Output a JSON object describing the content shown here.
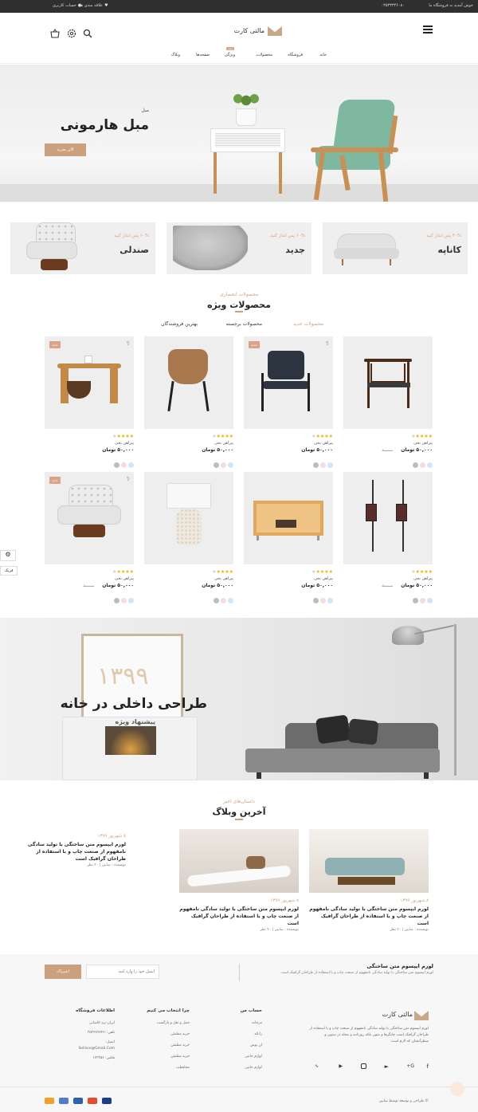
{
  "topbar": {
    "welcome": "خوش آمدید به فروشگاه ما",
    "phone": "۰۳۵۳۳۳۴۶۰۸۰",
    "account": "حساب کاربری",
    "wishlist": "علاقه مندی ها",
    "user_icon": "user-icon",
    "heart_icon": "heart-icon"
  },
  "header": {
    "logo_text": "مالتی کارت",
    "menu_icon": "menu-icon",
    "search_icon": "search-icon",
    "settings_icon": "gear-icon",
    "cart_icon": "basket-icon"
  },
  "nav": {
    "items": [
      "خانه",
      "فروشگاه",
      "محصولات",
      "ویژگی",
      "صفحه‌ها",
      "وبلاگ"
    ],
    "hot_badge": "جدید"
  },
  "hero": {
    "subtitle": "مبل",
    "title": "مبل هارمونی",
    "button": "الان بخرید"
  },
  "categories": [
    {
      "offer": "۳۰% پس انداز کنید",
      "name": "کاناپه"
    },
    {
      "offer": "۶۰% پس انداز کنید",
      "name": "جدید"
    },
    {
      "offer": "۶۰% پس انداز کنید",
      "name": "صندلی"
    }
  ],
  "products_section": {
    "kicker": "محصولات انحصاری",
    "title": "محصولات ویژه",
    "tabs": [
      "محصولات جدید",
      "محصولات برجسته",
      "بهترین فروشندگان"
    ]
  },
  "products": [
    {
      "name": "پیراهن نخی",
      "price": "۵۰,۰۰۰ تومان",
      "old": "۶۰,۰۰۰",
      "new": "",
      "hot": "",
      "img": "chair-wood"
    },
    {
      "name": "پیراهن نخی",
      "price": "۵۰,۰۰۰ تومان",
      "old": "",
      "new": "جدید",
      "hot": "داغ",
      "img": "office-chair"
    },
    {
      "name": "پیراهن نخی",
      "price": "۵۰,۰۰۰ تومان",
      "old": "",
      "new": "",
      "hot": "",
      "img": "lounge-chair"
    },
    {
      "name": "پیراهن نخی",
      "price": "۵۰,۰۰۰ تومان",
      "old": "",
      "new": "جدید",
      "hot": "داغ",
      "img": "side-table"
    },
    {
      "name": "پیراهن نخی",
      "price": "۵۰,۰۰۰ تومان",
      "old": "۶۰,۰۰۰",
      "new": "",
      "hot": "",
      "img": "lanterns"
    },
    {
      "name": "پیراهن نخی",
      "price": "۵۰,۰۰۰ تومان",
      "old": "",
      "new": "",
      "hot": "",
      "img": "coffee-table"
    },
    {
      "name": "پیراهن نخی",
      "price": "۵۰,۰۰۰ تومان",
      "old": "",
      "new": "",
      "hot": "",
      "img": "lamp"
    },
    {
      "name": "پیراهن نخی",
      "price": "۵۰,۰۰۰ تومان",
      "old": "۶۰,۰۰۰",
      "new": "جدید",
      "hot": "داغ",
      "img": "armchair"
    }
  ],
  "side_widget": {
    "label": "فریک",
    "gear_icon": "gear-icon"
  },
  "banner": {
    "year": "۱۳۹۹",
    "title": "طراحی داخلی در خانه",
    "subtitle": "پیشنهاد ویژه"
  },
  "blog": {
    "kicker": "داستان‌های اخیر",
    "title": "آخرین وبلاگ",
    "posts": [
      {
        "date": "۸ شهریور ۱۳۹۹",
        "text": "لورم ایپسوم متن ساختگی با تولید سادگی نامفهوم از صنعت چاپ و با استفاده از طراحان گرافیک است",
        "meta": "نویسنده : سایین | ۲۰ نظر"
      },
      {
        "date": "۸ شهریور ۱۳۹۹",
        "text": "لورم ایپسوم متن ساختگی با تولید سادگی نامفهوم از صنعت چاپ و با استفاده از طراحان گرافیک است",
        "meta": "نویسنده : سایین | ۲۰ نظر"
      },
      {
        "date": "۸ شهریور ۱۳۹۹",
        "text": "لورم ایپسوم متن ساختگی با تولید سادگی نامفهوم از صنعت چاپ و با استفاده از طراحان گرافیک است",
        "meta": "نویسنده : سایین | ۲۰ نظر"
      }
    ]
  },
  "newsletter": {
    "title": "لورم ایپسوم متن ساختگی",
    "text": "لورم ایپسوم متن ساختگی با تولید سادگی نامفهوم از صنعت چاپ و با استفاده از طراحان گرافیک است",
    "placeholder": "ایمیل خود را وارد کنید",
    "button": "اشتراک"
  },
  "footer": {
    "logo_text": "مالتی کارت",
    "about": "لورم ایپسوم متن ساختگی با تولید سادگی نامفهوم از صنعت چاپ و با استفاده از طراحان گرافیک است چاپگرها و متون بلکه روزنامه و مجله در ستون و سطرآنچنان که لازم است",
    "col_account_title": "حساب من",
    "col_account": [
      "مرجانه",
      "رانکه",
      "ان پوش",
      "لوازم جانبی",
      "لوازم جانبی"
    ],
    "col_why_title": "چرا انتخاب می کنیم",
    "col_why": [
      "حمل و نقل و بازگشت",
      "خرید مطمئن",
      "خرید مطمئن",
      "خرید مطمئن",
      "محافظت"
    ],
    "col_info_title": "اطلاعات فروشگاه",
    "col_info": [
      "ایران-یزد-کاشانی",
      "تلفن:۳۵۳۲۷۷۲۴۶۰",
      "ایمیل:",
      "Selinco@Gmail.Com",
      "فکس: ۱۲۳۴۵۶"
    ],
    "social": [
      "facebook-icon",
      "google-plus-icon",
      "twitter-icon",
      "instagram-icon",
      "youtube-icon",
      "rss-icon"
    ],
    "copyright": "© طراحی و توسعه توسط سایین",
    "payments": [
      "paypal-icon",
      "mastercard-icon",
      "visa-icon",
      "discover-icon",
      "maestro-icon"
    ]
  },
  "colors": {
    "accent": "#caa07f",
    "dark": "#2f2f2f",
    "star": "#f0b400"
  }
}
